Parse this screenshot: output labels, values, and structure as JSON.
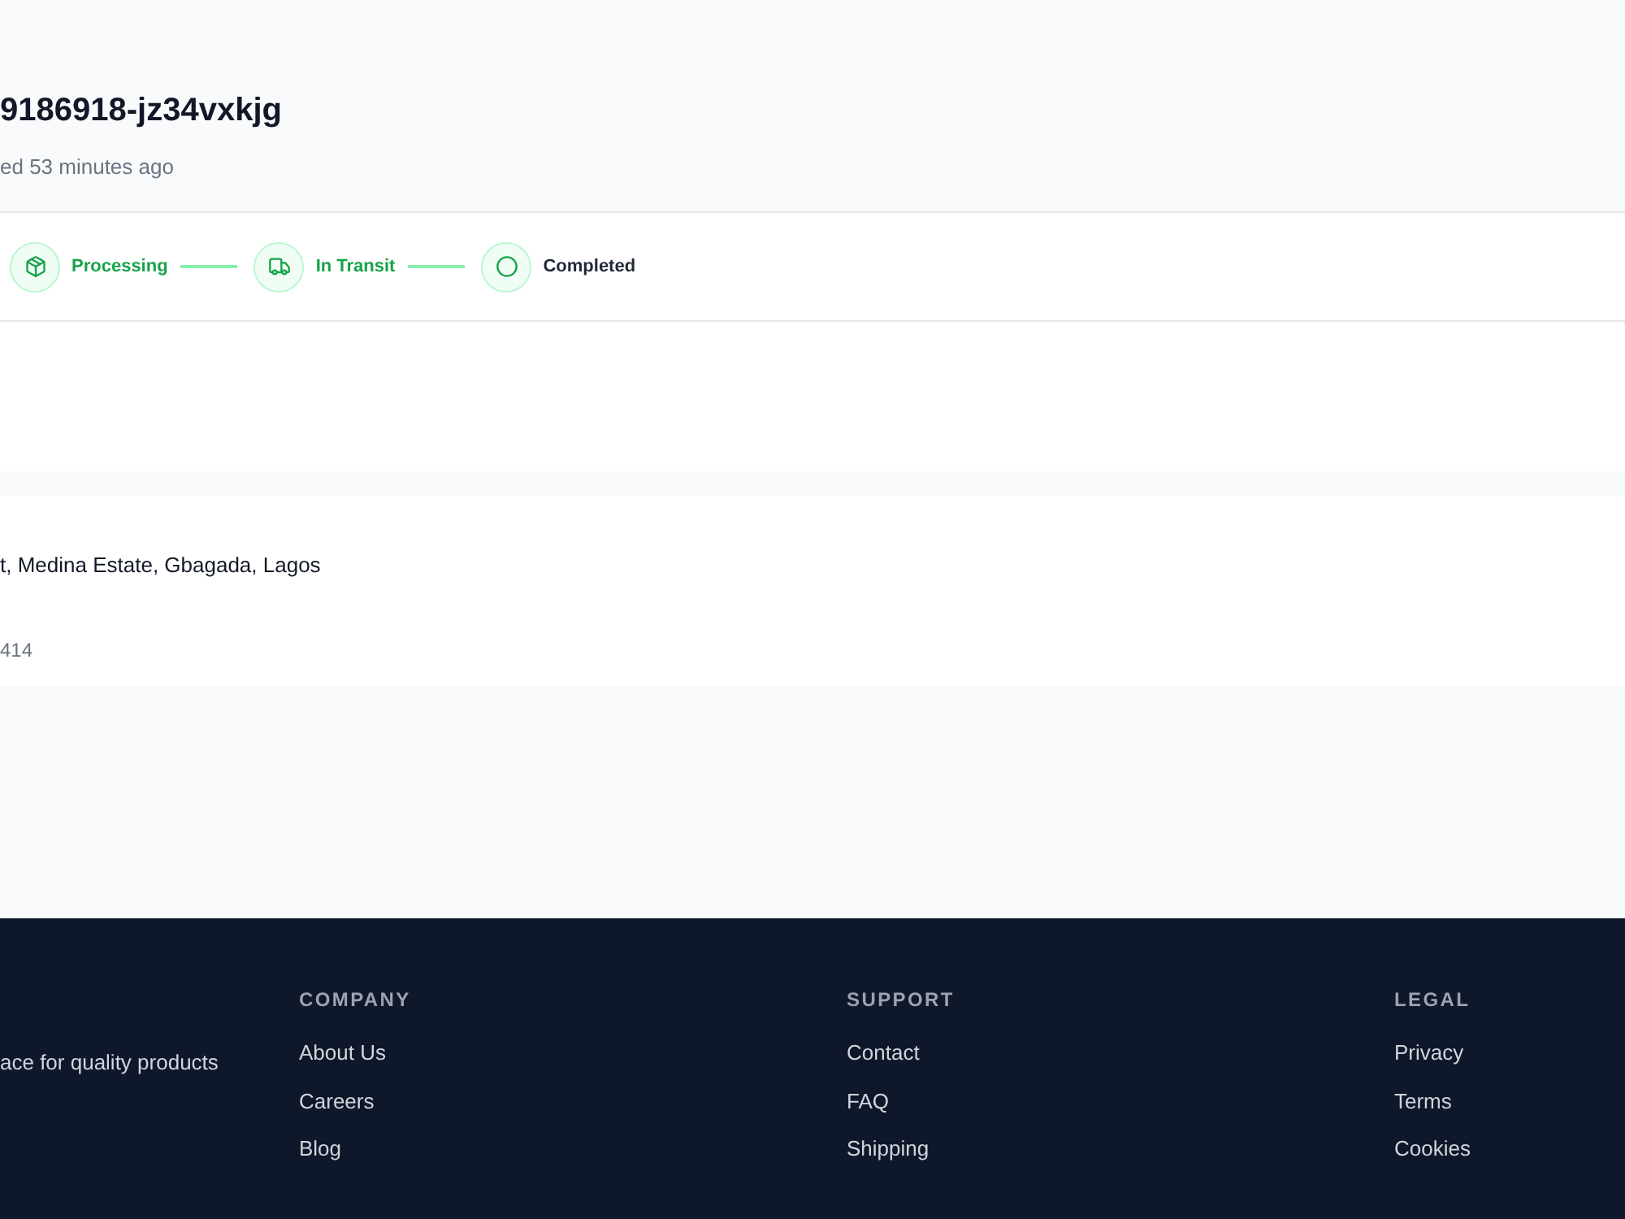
{
  "order": {
    "title": "9186918-jz34vxkjg",
    "subtitle": "ed 53 minutes ago"
  },
  "tracker": {
    "steps": [
      {
        "kind": "processing",
        "label": "Processing",
        "reached": true
      },
      {
        "kind": "transit",
        "label": "In Transit",
        "reached": true
      },
      {
        "kind": "completed",
        "label": "Completed",
        "reached": false
      }
    ]
  },
  "delivery": {
    "address": "t, Medina Estate, Gbagada, Lagos",
    "phone": "414"
  },
  "footer": {
    "tagline": "ace for quality products",
    "columns": [
      {
        "heading": "COMPANY",
        "links": [
          "About Us",
          "Careers",
          "Blog"
        ]
      },
      {
        "heading": "SUPPORT",
        "links": [
          "Contact",
          "FAQ",
          "Shipping"
        ]
      },
      {
        "heading": "LEGAL",
        "links": [
          "Privacy",
          "Terms",
          "Cookies"
        ]
      }
    ]
  }
}
